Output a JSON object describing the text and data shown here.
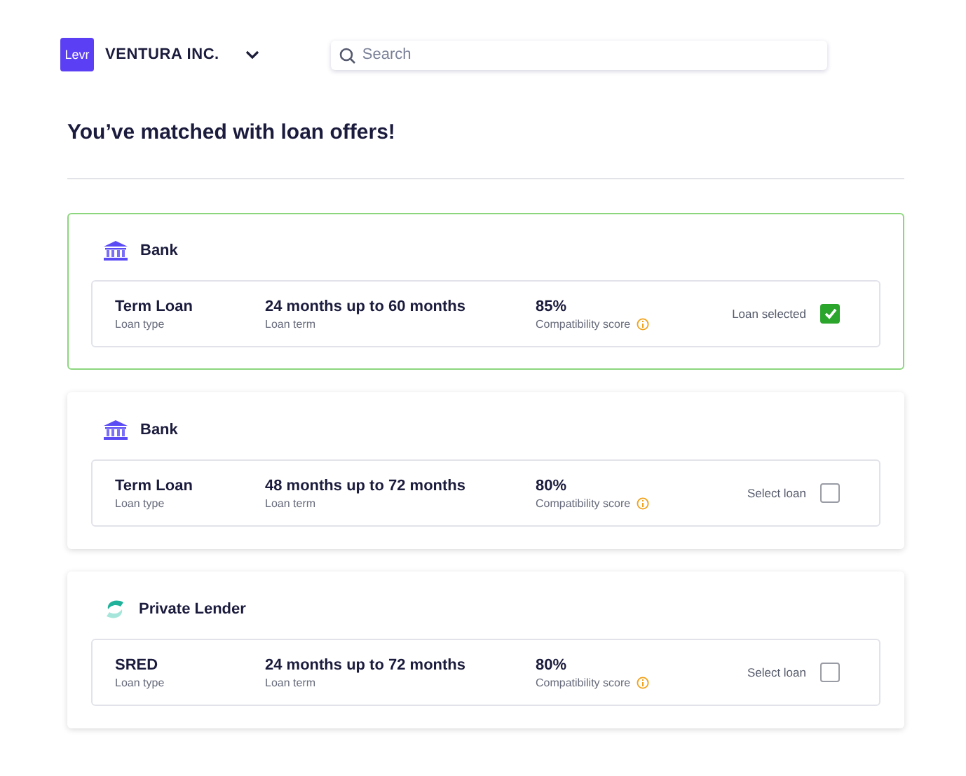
{
  "header": {
    "logo": "Levr",
    "company": "VENTURA INC.",
    "search": {
      "placeholder": "Search"
    }
  },
  "title": "You’ve matched with loan offers!",
  "offers": [
    {
      "lender": {
        "kind": "bank",
        "name": "Bank"
      },
      "type": "Term Loan",
      "type_label": "Loan type",
      "term": "24 months up to 60 months",
      "term_label": "Loan term",
      "score": "85%",
      "score_label": "Compatibility score",
      "select_label": "Loan selected",
      "selected": true
    },
    {
      "lender": {
        "kind": "bank",
        "name": "Bank"
      },
      "type": "Term Loan",
      "type_label": "Loan type",
      "term": "48 months up to 72 months",
      "term_label": "Loan term",
      "score": "80%",
      "score_label": "Compatibility score",
      "select_label": "Select loan",
      "selected": false
    },
    {
      "lender": {
        "kind": "private",
        "name": "Private Lender"
      },
      "type": "SRED",
      "type_label": "Loan type",
      "term": "24 months up to 72 months",
      "term_label": "Loan term",
      "score": "80%",
      "score_label": "Compatibility score",
      "select_label": "Select loan",
      "selected": false
    }
  ]
}
